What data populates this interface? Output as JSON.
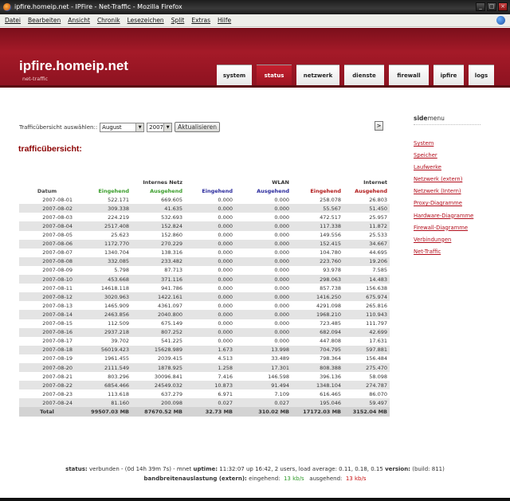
{
  "window": {
    "title": "ipfire.homeip.net - IPFire - Net-Traffic - Mozilla Firefox"
  },
  "menubar": [
    "Datei",
    "Bearbeiten",
    "Ansicht",
    "Chronik",
    "Lesezeichen",
    "Split",
    "Extras",
    "Hilfe"
  ],
  "header": {
    "title": "ipfire.homeip.net",
    "subtitle": "net-traffic",
    "tabs": [
      "system",
      "status",
      "netzwerk",
      "dienste",
      "firewall",
      "ipfire",
      "logs"
    ]
  },
  "controls": {
    "label": "Trafficübersicht auswählen::",
    "month": "August",
    "year": "2007",
    "update_button": "Aktualisieren",
    "next_button": ">"
  },
  "section_title": "trafficübersicht:",
  "table": {
    "groups": [
      "Internes Netz",
      "WLAN",
      "Internet"
    ],
    "headers": [
      "Datum",
      "Eingehend",
      "Ausgehend",
      "Eingehend",
      "Ausgehend",
      "Eingehend",
      "Ausgehend"
    ],
    "rows": [
      [
        "2007-08-01",
        "522.171",
        "669.605",
        "0.000",
        "0.000",
        "258.078",
        "26.803"
      ],
      [
        "2007-08-02",
        "309.338",
        "41.635",
        "0.000",
        "0.000",
        "55.567",
        "51.450"
      ],
      [
        "2007-08-03",
        "224.219",
        "532.693",
        "0.000",
        "0.000",
        "472.517",
        "25.957"
      ],
      [
        "2007-08-04",
        "2517.408",
        "152.824",
        "0.000",
        "0.000",
        "117.338",
        "11.872"
      ],
      [
        "2007-08-05",
        "25.623",
        "152.860",
        "0.000",
        "0.000",
        "149.556",
        "25.533"
      ],
      [
        "2007-08-06",
        "1172.770",
        "270.229",
        "0.000",
        "0.000",
        "152.415",
        "34.667"
      ],
      [
        "2007-08-07",
        "1340.704",
        "138.316",
        "0.000",
        "0.000",
        "104.780",
        "44.695"
      ],
      [
        "2007-08-08",
        "332.085",
        "233.482",
        "0.000",
        "0.000",
        "223.760",
        "19.206"
      ],
      [
        "2007-08-09",
        "5.798",
        "87.713",
        "0.000",
        "0.000",
        "93.978",
        "7.585"
      ],
      [
        "2007-08-10",
        "453.668",
        "371.116",
        "0.000",
        "0.000",
        "298.063",
        "14.483"
      ],
      [
        "2007-08-11",
        "14618.118",
        "941.786",
        "0.000",
        "0.000",
        "857.738",
        "156.638"
      ],
      [
        "2007-08-12",
        "3020.963",
        "1422.161",
        "0.000",
        "0.000",
        "1416.250",
        "675.974"
      ],
      [
        "2007-08-13",
        "1465.909",
        "4361.097",
        "0.000",
        "0.000",
        "4291.098",
        "265.816"
      ],
      [
        "2007-08-14",
        "2463.856",
        "2040.800",
        "0.000",
        "0.000",
        "1968.210",
        "110.943"
      ],
      [
        "2007-08-15",
        "112.509",
        "675.149",
        "0.000",
        "0.000",
        "723.485",
        "111.797"
      ],
      [
        "2007-08-16",
        "2937.218",
        "807.252",
        "0.000",
        "0.000",
        "682.094",
        "42.699"
      ],
      [
        "2007-08-17",
        "39.702",
        "541.225",
        "0.000",
        "0.000",
        "447.808",
        "17.631"
      ],
      [
        "2007-08-18",
        "56019.423",
        "15628.989",
        "1.673",
        "13.998",
        "704.795",
        "597.881"
      ],
      [
        "2007-08-19",
        "1961.455",
        "2039.415",
        "4.513",
        "33.489",
        "798.364",
        "156.484"
      ],
      [
        "2007-08-20",
        "2111.549",
        "1878.925",
        "1.258",
        "17.301",
        "808.388",
        "275.470"
      ],
      [
        "2007-08-21",
        "803.296",
        "30096.841",
        "7.416",
        "146.598",
        "396.136",
        "58.098"
      ],
      [
        "2007-08-22",
        "6854.466",
        "24549.032",
        "10.873",
        "91.494",
        "1348.104",
        "274.787"
      ],
      [
        "2007-08-23",
        "113.618",
        "637.279",
        "6.971",
        "7.109",
        "616.465",
        "86.070"
      ],
      [
        "2007-08-24",
        "81.160",
        "200.098",
        "0.027",
        "0.027",
        "195.046",
        "59.497"
      ]
    ],
    "total": [
      "Total",
      "99507.03 MB",
      "87670.52 MB",
      "32.73 MB",
      "310.02 MB",
      "17172.03 MB",
      "3152.04 MB"
    ]
  },
  "sidemenu": {
    "title_bold": "side",
    "title_rest": "menu",
    "items": [
      "System",
      "Speicher",
      "Laufwerke",
      "Netzwerk (extern)",
      "Netzwerk (Intern)",
      "Proxy-Diagramme",
      "Hardware-Diagramme",
      "Firewall-Diagramme",
      "Verbindungen",
      "Net-Traffic"
    ]
  },
  "footer": {
    "status_label": "status:",
    "status_text": "verbunden - (0d 14h 39m 7s) - mnet",
    "uptime_label": "uptime:",
    "uptime_text": "11:32:07 up 16:42, 2 users, load average: 0.11, 0.18, 0.15",
    "version_label": "version:",
    "version_text": "(build: 811)",
    "bw_label": "bandbreitenauslastung (extern):",
    "in_label": "eingehend:",
    "in_value": "13 kb/s",
    "out_label": "ausgehend:",
    "out_value": "13 kb/s"
  }
}
